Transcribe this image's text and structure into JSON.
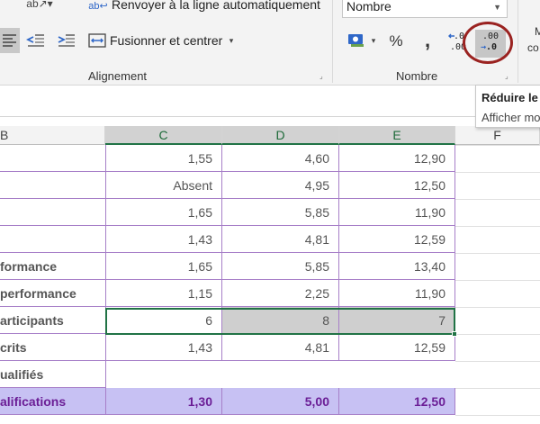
{
  "ribbon": {
    "wrap_text": "Renvoyer à la ligne automatiquement",
    "merge_center": "Fusionner et centrer",
    "alignment_label": "Alignement",
    "number_label": "Nombre",
    "number_format": "Nombre",
    "percent": "%",
    "comma": "❜",
    "currency_caret": "▾",
    "decrease_top": ".00",
    "decrease_bottom_arrow": "→",
    "decrease_bottom": ".0",
    "increase_top": "←.0",
    "increase_bottom": ".00",
    "cut_top": "M",
    "cut_bottom": "co"
  },
  "tooltip": {
    "title": "Réduire le",
    "description": "Afficher mo"
  },
  "columns": [
    "B",
    "C",
    "D",
    "E",
    "F"
  ],
  "rows": [
    {
      "label": "",
      "c": "1,55",
      "d": "4,60",
      "e": "12,90"
    },
    {
      "label": "",
      "c": "Absent",
      "d": "4,95",
      "e": "12,50"
    },
    {
      "label": "",
      "c": "1,65",
      "d": "5,85",
      "e": "11,90"
    },
    {
      "label": "",
      "c": "1,43",
      "d": "4,81",
      "e": "12,59"
    },
    {
      "label": "formance",
      "c": "1,65",
      "d": "5,85",
      "e": "13,40"
    },
    {
      "label": "performance",
      "c": "1,15",
      "d": "2,25",
      "e": "11,90"
    },
    {
      "label": "articipants",
      "c": "6",
      "d": "8",
      "e": "7"
    },
    {
      "label": "crits",
      "c": "1,43",
      "d": "4,81",
      "e": "12,59"
    },
    {
      "label": "ualifiés",
      "c": "",
      "d": "",
      "e": ""
    },
    {
      "label": "alifications",
      "c": "1,30",
      "d": "5,00",
      "e": "12,50"
    }
  ],
  "colors": {
    "accent_green": "#217346",
    "highlight_circle": "#9a2220",
    "total_row_bg": "#c7c1f3",
    "total_row_text": "#6b1e96"
  }
}
